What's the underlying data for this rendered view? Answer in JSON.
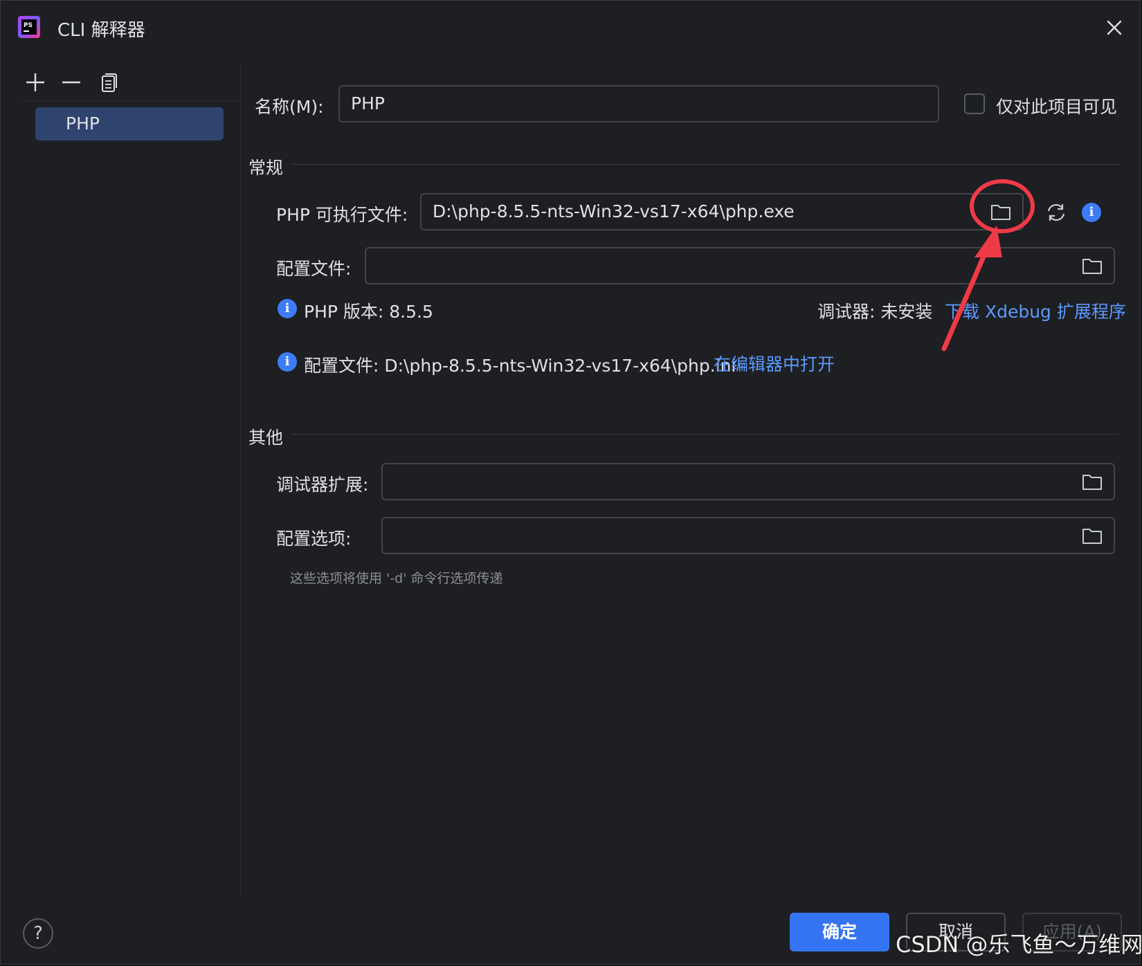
{
  "window": {
    "title": "CLI 解释器"
  },
  "sidebar": {
    "items": [
      {
        "label": "PHP",
        "selected": true
      }
    ]
  },
  "form": {
    "name_label": "名称(M):",
    "name_value": "PHP",
    "project_only_label": "仅对此项目可见",
    "project_only_checked": false,
    "general_section": "常规",
    "php_exe_label": "PHP 可执行文件:",
    "php_exe_value": "D:\\php-8.5.5-nts-Win32-vs17-x64\\php.exe",
    "config_file_label": "配置文件:",
    "config_file_value": "",
    "php_version_text": "PHP 版本: 8.5.5",
    "debugger_status": "调试器: 未安装",
    "download_xdebug_link": "下载 Xdebug 扩展程序",
    "config_info_text": "配置文件: D:\\php-8.5.5-nts-Win32-vs17-x64\\php.ini",
    "open_in_editor_link": "在编辑器中打开",
    "other_section": "其他",
    "debugger_ext_label": "调试器扩展:",
    "debugger_ext_value": "",
    "config_options_label": "配置选项:",
    "config_options_value": "",
    "config_options_hint": "这些选项将使用 '-d' 命令行选项传递"
  },
  "footer": {
    "help_label": "?",
    "ok_label": "确定",
    "cancel_label": "取消",
    "apply_label": "应用(A)"
  },
  "watermark": "CSDN @乐飞鱼～万维网",
  "colors": {
    "accent": "#3574f0",
    "link": "#5b9aff",
    "selection": "#2e436e",
    "annotation": "#f03a47"
  },
  "icons": [
    "phpstorm-logo-icon",
    "close-icon",
    "add-icon",
    "remove-icon",
    "copy-icon",
    "folder-icon",
    "refresh-icon",
    "info-icon",
    "help-icon"
  ]
}
